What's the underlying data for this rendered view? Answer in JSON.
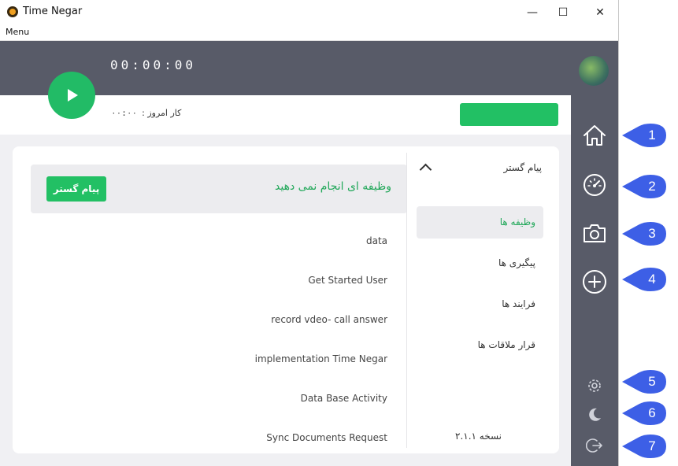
{
  "window": {
    "title": "Time Negar",
    "minimize": "—",
    "maximize": "☐",
    "close": "✕"
  },
  "menubar": {
    "menu": "Menu"
  },
  "header": {
    "timer": "00:00:00",
    "today_label": "کار امروز :",
    "today_value": "۰۰:۰۰"
  },
  "banner": {
    "message": "وظیفه ای انجام نمی دهید",
    "button": "پیام گستر"
  },
  "tasks": [
    "data",
    "Get Started User",
    "record vdeo- call answer",
    "implementation Time Negar",
    "Data Base Activity",
    "Sync Documents Request"
  ],
  "side": {
    "title": "پیام گستر",
    "items": [
      "وظیفه ها",
      "پیگیری ها",
      "فرایند ها",
      "قرار ملاقات ها"
    ],
    "active_index": 0,
    "version": "نسخه ۲.۱.۱"
  },
  "rail": {
    "icons": [
      "home-icon",
      "dashboard-icon",
      "camera-icon",
      "add-icon",
      "settings-icon",
      "moon-icon",
      "logout-icon"
    ]
  },
  "markers": [
    "1",
    "2",
    "3",
    "4",
    "5",
    "6",
    "7"
  ],
  "colors": {
    "accent_green": "#22c064",
    "rail": "#585b68",
    "marker": "#3d5fe6"
  }
}
